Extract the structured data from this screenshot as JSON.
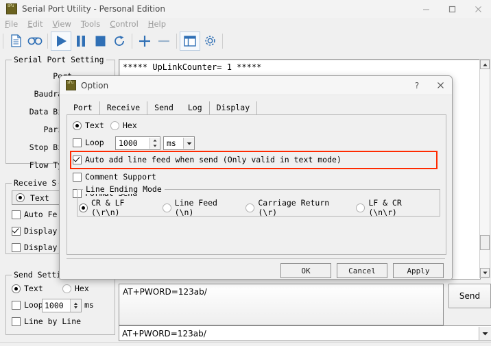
{
  "window": {
    "title": "Serial Port Utility - Personal Edition",
    "icon": "app-icon",
    "controls": {
      "minimize": "–",
      "maximize": "□",
      "close": "✕"
    }
  },
  "menubar": {
    "items": [
      {
        "acc": "F",
        "rest": "ile"
      },
      {
        "acc": "E",
        "rest": "dit"
      },
      {
        "acc": "V",
        "rest": "iew"
      },
      {
        "acc": "T",
        "rest": "ools"
      },
      {
        "acc": "C",
        "rest": "ontrol"
      },
      {
        "acc": "H",
        "rest": "elp"
      }
    ]
  },
  "toolbar": {
    "buttons": [
      "new-file-icon",
      "record-icon",
      "play-icon",
      "pause-icon",
      "stop-icon",
      "refresh-icon",
      "add-icon",
      "remove-icon",
      "layout-icon",
      "settings-gear-icon"
    ]
  },
  "sidebar": {
    "serial_port_setting": {
      "title": "Serial Port Setting",
      "rows": [
        "Port",
        "Baudrate",
        "Data Bits",
        "Parity",
        "Stop Bits",
        "Flow Type"
      ]
    },
    "receive_setting": {
      "title": "Receive S",
      "mode_text": "Text",
      "options": [
        {
          "label": "Auto Fe",
          "checked": false
        },
        {
          "label": "Display",
          "checked": true
        },
        {
          "label": "Display",
          "checked": false
        }
      ]
    },
    "send_setting": {
      "title": "Send Setting",
      "mode_text": "Text",
      "mode_hex": "Hex",
      "loop_label": "Loop",
      "loop_value": "1000",
      "loop_unit": "ms",
      "line_by_line": "Line by Line"
    }
  },
  "receive_panel": {
    "text": "***** UpLinkCounter= 1 *****"
  },
  "send_area": {
    "input_value": "AT+PWORD=123ab/",
    "history_value": "AT+PWORD=123ab/",
    "send_button": "Send"
  },
  "dialog": {
    "title": "Option",
    "help_btn": "?",
    "close_btn": "✕",
    "tabs": [
      {
        "label": "Port",
        "active": false
      },
      {
        "label": "Receive",
        "active": false
      },
      {
        "label": "Send",
        "active": true
      },
      {
        "label": "Log",
        "active": false
      },
      {
        "label": "Display",
        "active": false
      }
    ],
    "send_tab": {
      "mode": {
        "text": "Text",
        "hex": "Hex",
        "selected": "Text"
      },
      "loop": {
        "label": "Loop",
        "checked": false,
        "value": "1000",
        "unit": "ms"
      },
      "auto_add_line_feed": {
        "label": "Auto add line feed when send (Only valid in text mode)",
        "checked": true,
        "highlight_color": "#ff2a00"
      },
      "comment_support": {
        "label": "Comment Support",
        "checked": false
      },
      "format_send": {
        "label": "Format Send",
        "checked": false
      },
      "line_ending_mode": {
        "title": "Line Ending Mode",
        "options": [
          {
            "label": "CR & LF (\\r\\n)",
            "selected": true
          },
          {
            "label": "Line Feed (\\n)",
            "selected": false
          },
          {
            "label": "Carriage Return (\\r)",
            "selected": false
          },
          {
            "label": "LF & CR (\\n\\r)",
            "selected": false
          }
        ]
      }
    },
    "buttons": {
      "ok": "OK",
      "cancel": "Cancel",
      "apply": "Apply"
    }
  },
  "colors": {
    "accent_blue": "#2f6fb5",
    "highlight_red": "#ff2a00",
    "window_bg": "#f0f0f0"
  }
}
